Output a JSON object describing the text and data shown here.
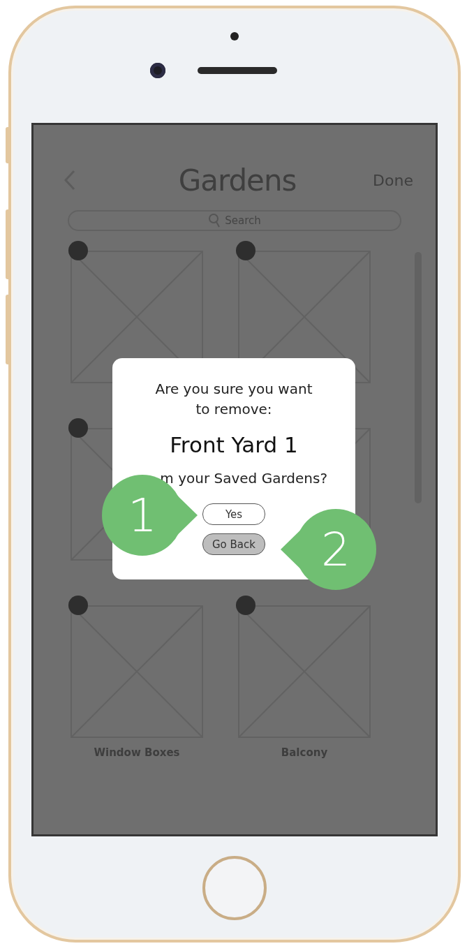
{
  "screen": {
    "title": "Gardens",
    "done_button": "Done",
    "search": {
      "placeholder": "Search"
    },
    "gardens": [
      {
        "kind": "placeholder"
      },
      {
        "kind": "placeholder"
      },
      {
        "kind": "placeholder"
      },
      {
        "kind": "placeholder"
      },
      {
        "kind": "placeholder",
        "label": "Window Boxes"
      },
      {
        "kind": "placeholder",
        "label": "Balcony"
      }
    ]
  },
  "dialog": {
    "message": "Are you sure you want to remove:",
    "item_name": "Front Yard 1",
    "message_end": "m your Saved Gardens?",
    "buttons": [
      {
        "label": "Yes",
        "kind": "outline"
      },
      {
        "label": "Go Back",
        "kind": "filled"
      }
    ]
  },
  "callouts": [
    {
      "number": "1"
    },
    {
      "number": "2"
    }
  ]
}
